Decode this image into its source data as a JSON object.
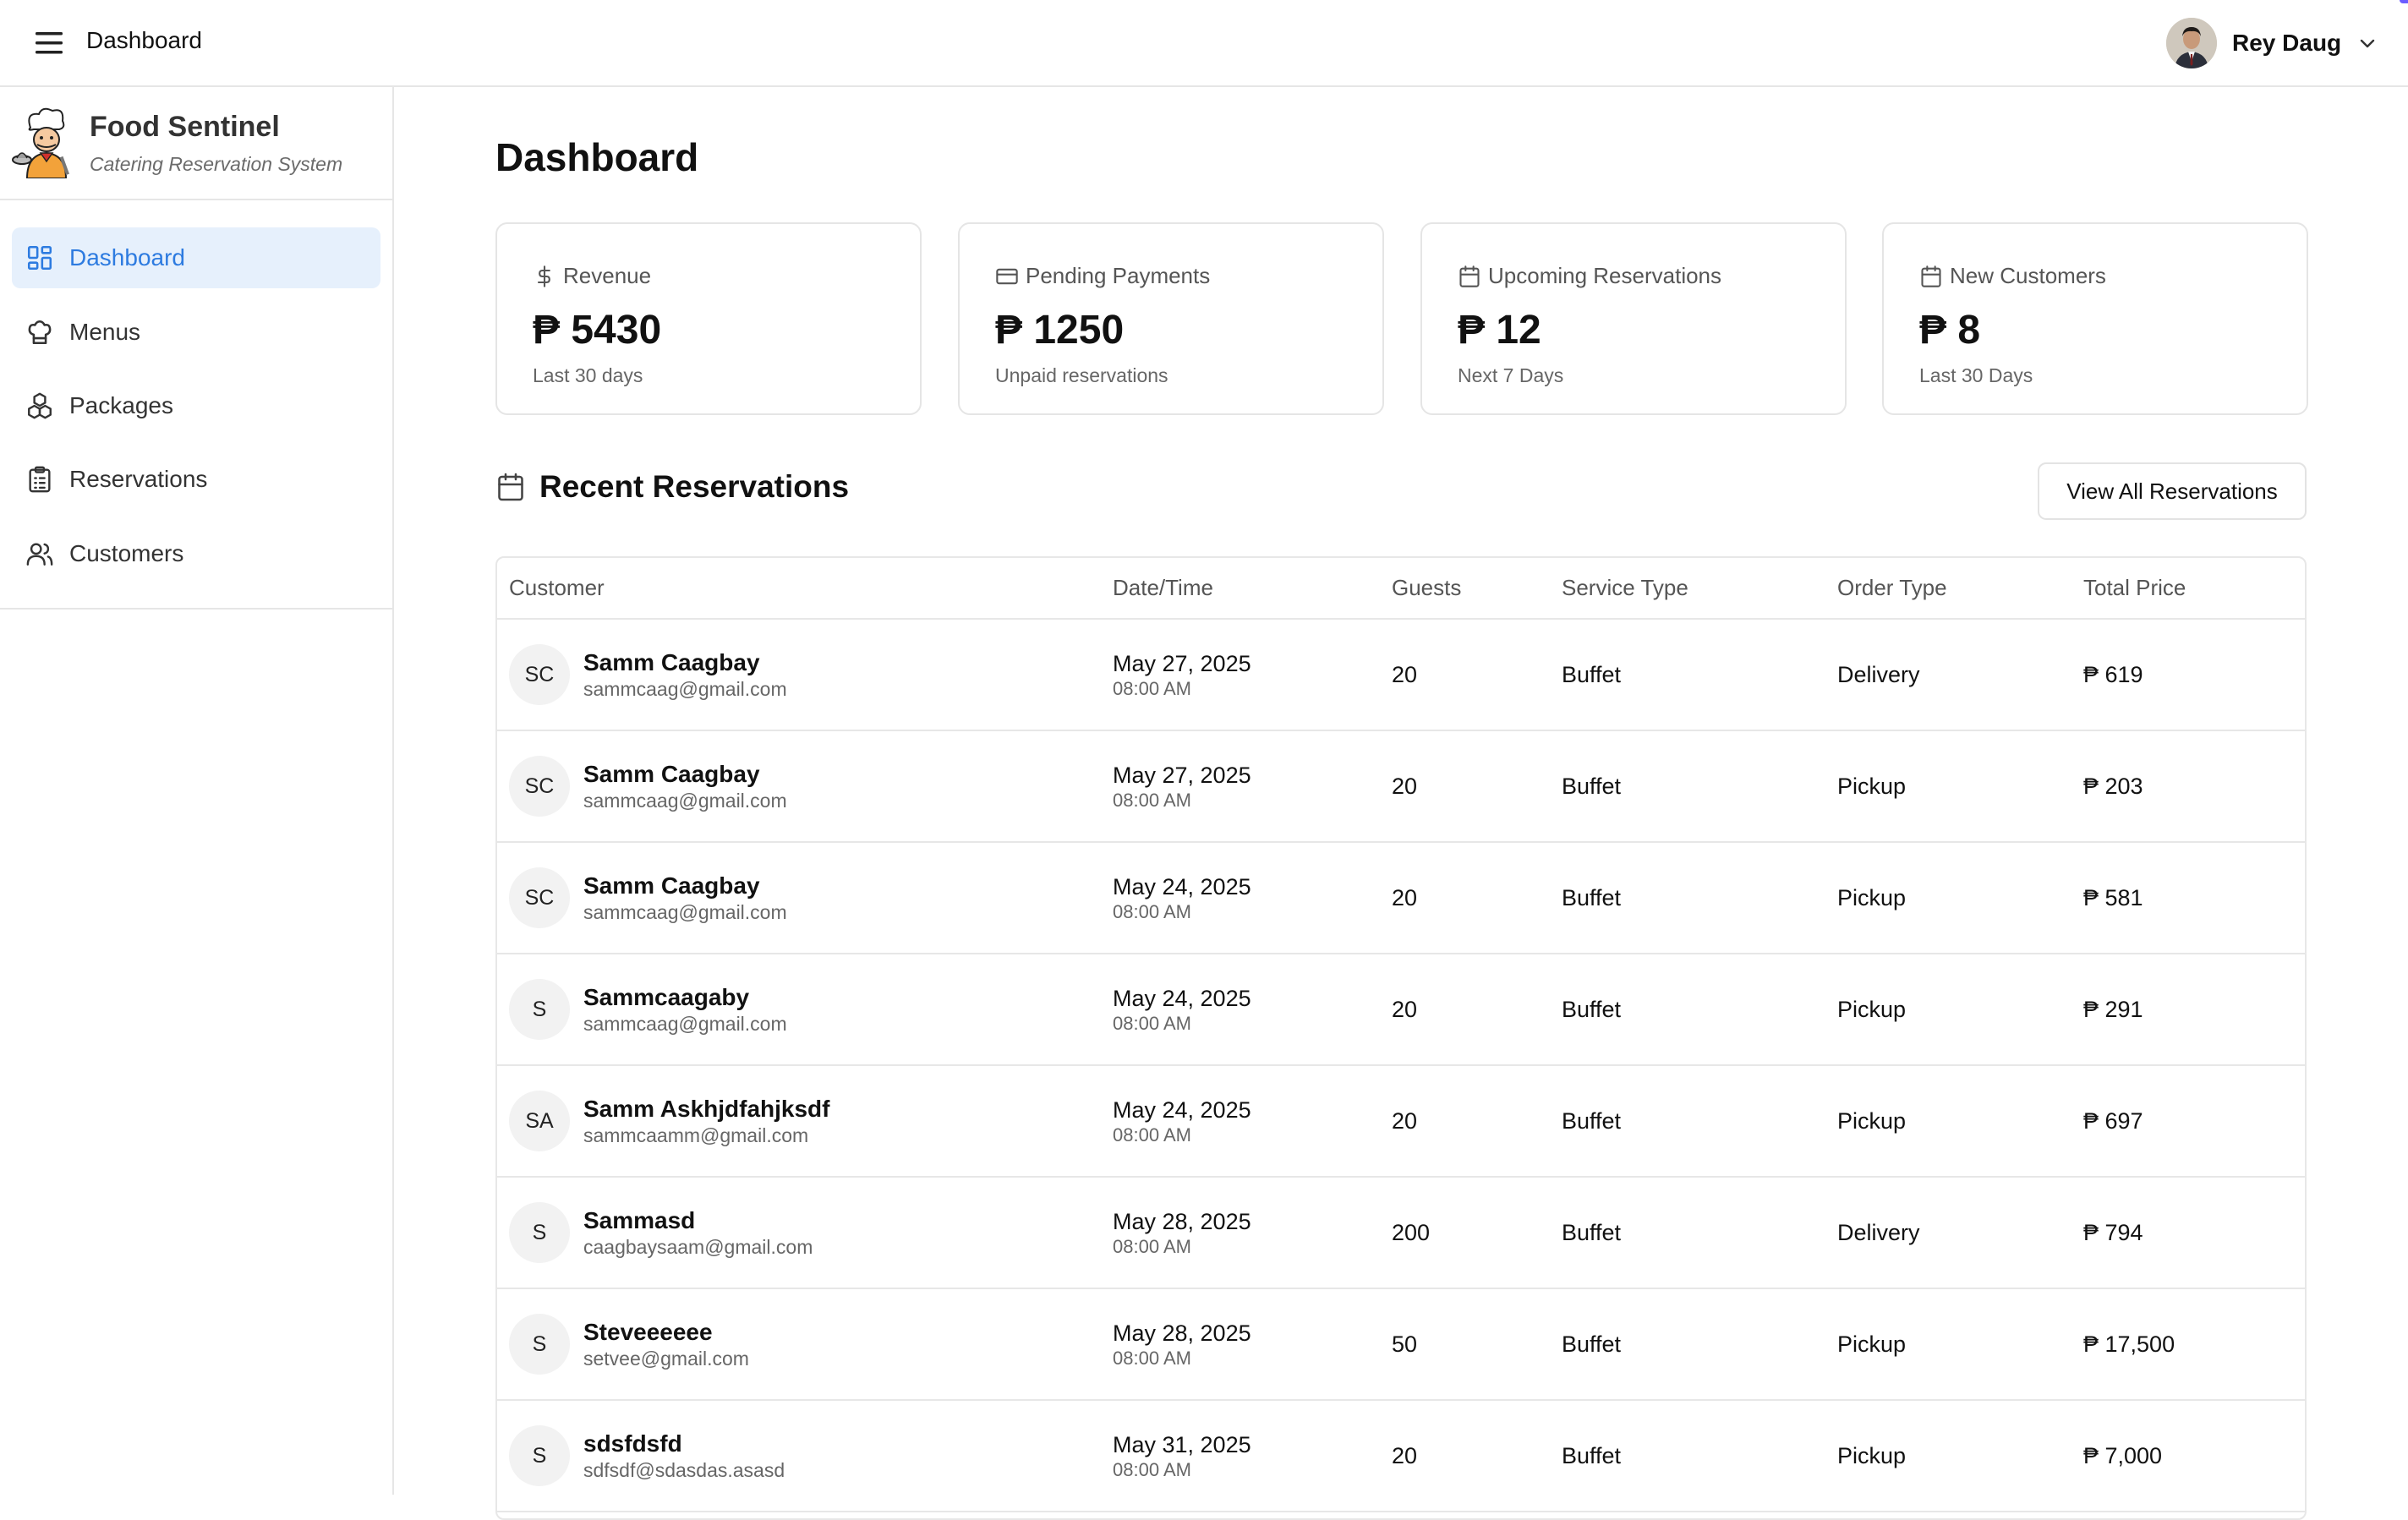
{
  "topbar": {
    "title": "Dashboard",
    "user_name": "Rey Daug"
  },
  "brand": {
    "title": "Food Sentinel",
    "subtitle": "Catering Reservation System"
  },
  "nav": [
    {
      "label": "Dashboard",
      "icon": "dashboard-icon",
      "active": true
    },
    {
      "label": "Menus",
      "icon": "chef-hat-icon"
    },
    {
      "label": "Packages",
      "icon": "packages-icon"
    },
    {
      "label": "Reservations",
      "icon": "clipboard-list-icon"
    },
    {
      "label": "Customers",
      "icon": "users-icon"
    }
  ],
  "page": {
    "title": "Dashboard"
  },
  "stats": [
    {
      "label": "Revenue",
      "value": "₱ 5430",
      "sub": "Last 30 days",
      "icon": "dollar-icon"
    },
    {
      "label": "Pending Payments",
      "value": "₱ 1250",
      "sub": "Unpaid reservations",
      "icon": "credit-card-icon"
    },
    {
      "label": "Upcoming Reservations",
      "value": "₱ 12",
      "sub": "Next 7 Days",
      "icon": "calendar-icon"
    },
    {
      "label": "New Customers",
      "value": "₱ 8",
      "sub": "Last 30 Days",
      "icon": "calendar-icon"
    }
  ],
  "recent": {
    "title": "Recent Reservations",
    "view_all_label": "View All Reservations",
    "columns": [
      "Customer",
      "Date/Time",
      "Guests",
      "Service Type",
      "Order Type",
      "Total Price"
    ],
    "rows": [
      {
        "initials": "SC",
        "name": "Samm Caagbay",
        "email": "sammcaag@gmail.com",
        "date": "May 27, 2025",
        "time": "08:00 AM",
        "guests": "20",
        "service": "Buffet",
        "order": "Delivery",
        "price": "₱ 619"
      },
      {
        "initials": "SC",
        "name": "Samm Caagbay",
        "email": "sammcaag@gmail.com",
        "date": "May 27, 2025",
        "time": "08:00 AM",
        "guests": "20",
        "service": "Buffet",
        "order": "Pickup",
        "price": "₱ 203"
      },
      {
        "initials": "SC",
        "name": "Samm Caagbay",
        "email": "sammcaag@gmail.com",
        "date": "May 24, 2025",
        "time": "08:00 AM",
        "guests": "20",
        "service": "Buffet",
        "order": "Pickup",
        "price": "₱ 581"
      },
      {
        "initials": "S",
        "name": "Sammcaagaby",
        "email": "sammcaag@gmail.com",
        "date": "May 24, 2025",
        "time": "08:00 AM",
        "guests": "20",
        "service": "Buffet",
        "order": "Pickup",
        "price": "₱ 291"
      },
      {
        "initials": "SA",
        "name": "Samm Askhjdfahjksdf",
        "email": "sammcaamm@gmail.com",
        "date": "May 24, 2025",
        "time": "08:00 AM",
        "guests": "20",
        "service": "Buffet",
        "order": "Pickup",
        "price": "₱ 697"
      },
      {
        "initials": "S",
        "name": "Sammasd",
        "email": "caagbaysaam@gmail.com",
        "date": "May 28, 2025",
        "time": "08:00 AM",
        "guests": "200",
        "service": "Buffet",
        "order": "Delivery",
        "price": "₱ 794"
      },
      {
        "initials": "S",
        "name": "Steveeeeee",
        "email": "setvee@gmail.com",
        "date": "May 28, 2025",
        "time": "08:00 AM",
        "guests": "50",
        "service": "Buffet",
        "order": "Pickup",
        "price": "₱ 17,500"
      },
      {
        "initials": "S",
        "name": "sdsfdsfd",
        "email": "sdfsdf@sdasdas.asasd",
        "date": "May 31, 2025",
        "time": "08:00 AM",
        "guests": "20",
        "service": "Buffet",
        "order": "Pickup",
        "price": "₱ 7,000"
      }
    ]
  },
  "colors": {
    "accent": "#2d7be0",
    "active_bg": "#e6f0fc",
    "border": "#e6e6e6"
  }
}
